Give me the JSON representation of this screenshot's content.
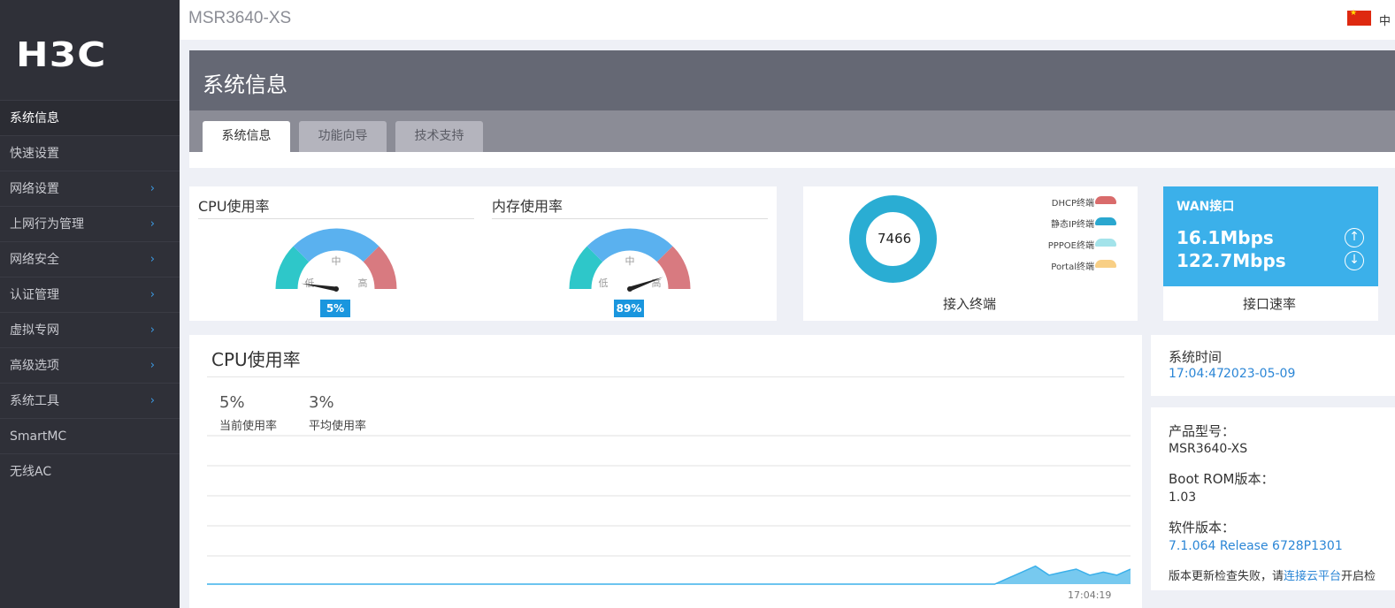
{
  "sidebar": {
    "logo": "H3C",
    "items": [
      {
        "label": "系统信息",
        "active": true,
        "chevron": ""
      },
      {
        "label": "快速设置",
        "active": false,
        "chevron": ""
      },
      {
        "label": "网络设置",
        "active": false,
        "chevron": "›"
      },
      {
        "label": "上网行为管理",
        "active": false,
        "chevron": "›"
      },
      {
        "label": "网络安全",
        "active": false,
        "chevron": "›"
      },
      {
        "label": "认证管理",
        "active": false,
        "chevron": "›"
      },
      {
        "label": "虚拟专网",
        "active": false,
        "chevron": "›"
      },
      {
        "label": "高级选项",
        "active": false,
        "chevron": "›"
      },
      {
        "label": "系统工具",
        "active": false,
        "chevron": "›"
      },
      {
        "label": "SmartMC",
        "active": false,
        "chevron": ""
      },
      {
        "label": "无线AC",
        "active": false,
        "chevron": ""
      }
    ]
  },
  "topbar": {
    "model": "MSR3640-XS",
    "lang": "中"
  },
  "header": {
    "title": "系统信息",
    "tabs": [
      {
        "label": "系统信息",
        "active": true
      },
      {
        "label": "功能向导",
        "active": false
      },
      {
        "label": "技术支持",
        "active": false
      }
    ]
  },
  "gauges": {
    "cpu": {
      "title": "CPU使用率",
      "value": "5%",
      "fraction": 0.05,
      "low": "低",
      "mid": "中",
      "high": "高"
    },
    "mem": {
      "title": "内存使用率",
      "value": "89%",
      "fraction": 0.89,
      "low": "低",
      "mid": "中",
      "high": "高"
    }
  },
  "terminals": {
    "total": "7466",
    "caption": "接入终端",
    "legend": [
      {
        "label": "DHCP终端",
        "color": "#d96b6b"
      },
      {
        "label": "静态IP终端",
        "color": "#2aa7cf"
      },
      {
        "label": "PPPOE终端",
        "color": "#a3e3ea"
      },
      {
        "label": "Portal终端",
        "color": "#f8cf85"
      }
    ],
    "colors": {
      "ring": "#2aadd3"
    }
  },
  "wan": {
    "title": "WAN接口",
    "up": "16.1Mbps",
    "down": "122.7Mbps",
    "caption": "接口速率",
    "up_icon": "↑",
    "down_icon": "↓"
  },
  "cpu_chart": {
    "title": "CPU使用率",
    "current_value": "5%",
    "current_label": "当前使用率",
    "avg_value": "3%",
    "avg_label": "平均使用率",
    "time_label": "17:04:19"
  },
  "chart_data": {
    "type": "area",
    "title": "CPU使用率",
    "xlabel": "",
    "ylabel": "",
    "x": [
      "17:04:19"
    ],
    "series": [
      {
        "values": [
          0,
          0,
          0,
          0,
          0,
          0,
          0,
          0,
          0,
          0,
          0,
          0,
          0,
          0,
          0,
          0,
          0,
          0,
          0,
          0,
          0,
          0,
          0,
          0,
          0,
          0,
          0,
          0,
          0,
          0,
          0,
          0,
          0,
          0,
          0,
          0,
          0,
          0,
          0,
          0,
          0,
          0,
          0,
          0,
          0,
          0,
          0,
          0,
          0,
          0,
          0,
          0,
          0,
          0,
          0,
          0,
          0,
          0,
          0,
          2,
          4,
          6,
          3,
          4,
          5,
          3,
          4,
          3,
          5
        ]
      }
    ],
    "grid": true
  },
  "system_time": {
    "label": "系统时间",
    "time": "17:04:47",
    "date": "2023-05-09"
  },
  "product": {
    "model_label": "产品型号：",
    "model_value": "MSR3640-XS",
    "bootrom_label": "Boot ROM版本：",
    "bootrom_value": "1.03",
    "software_label": "软件版本：",
    "software_value": "7.1.064 Release 6728P1301",
    "note_prefix": "版本更新检查失败，请",
    "note_link": "连接云平台",
    "note_suffix": "开启检"
  }
}
